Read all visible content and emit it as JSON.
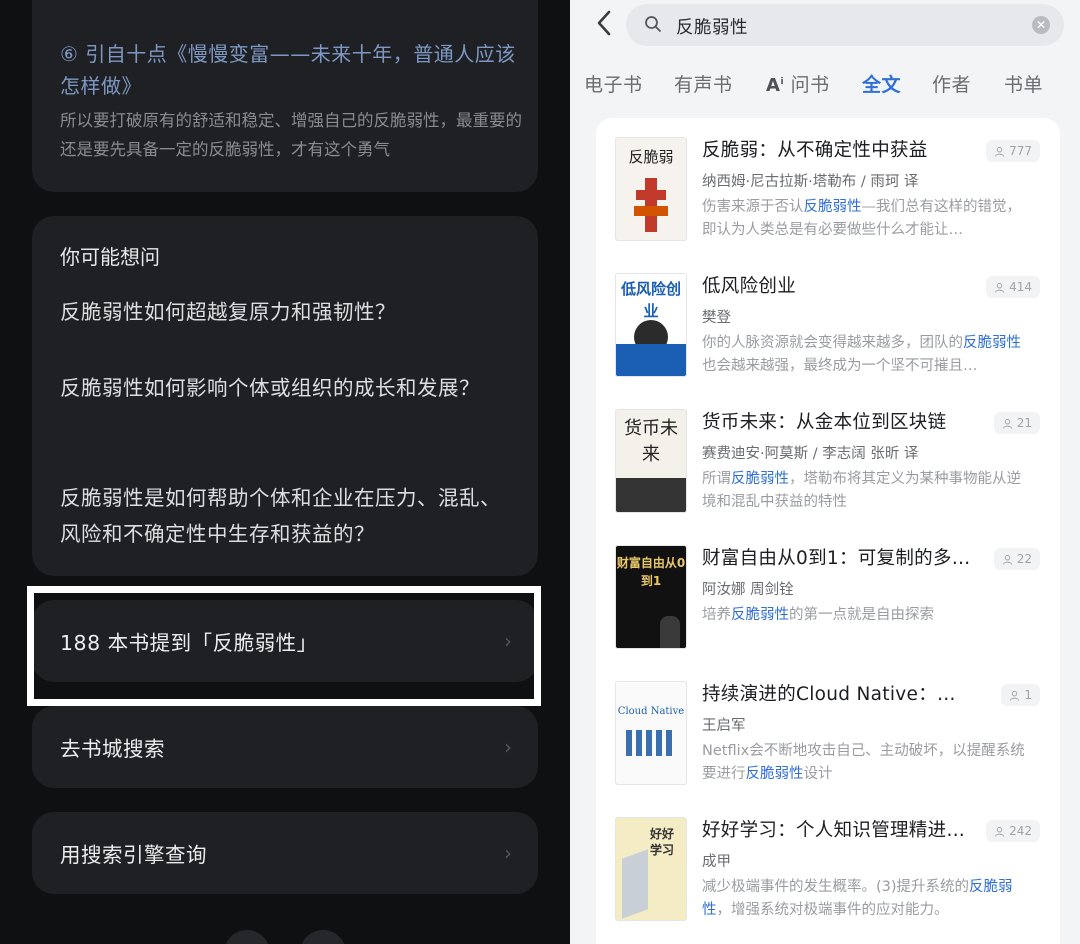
{
  "left": {
    "quote": {
      "title": "⑥ 引自十点《慢慢变富——未来十年，普通人应该怎样做》",
      "body": "所以要打破原有的舒适和稳定、增强自己的反脆弱性，最重要的还是要先具备一定的反脆弱性，才有这个勇气"
    },
    "ask": {
      "heading": "你可能想问",
      "questions": [
        "反脆弱性如何超越复原力和强韧性？",
        "反脆弱性如何影响个体或组织的成长和发展？",
        "反脆弱性是如何帮助个体和企业在压力、混乱、风险和不确定性中生存和获益的？"
      ]
    },
    "rows": {
      "books_mention": "188 本书提到「反脆弱性」",
      "store_search": "去书城搜索",
      "engine_search": "用搜索引擎查询"
    }
  },
  "right": {
    "search": {
      "query": "反脆弱性"
    },
    "tabs": [
      "电子书",
      "有声书",
      "问书",
      "全文",
      "作者",
      "书单"
    ],
    "active_tab": "全文",
    "results": [
      {
        "title": "反脆弱：从不确定性中获益",
        "author": "纳西姆·尼古拉斯·塔勒布 / 雨珂 译",
        "snippet_pre": "伤害来源于否认",
        "snippet_hl": "反脆弱性",
        "snippet_post": "—我们总有这样的错觉，即认为人类总是有必要做些什么才能让…",
        "count": "777",
        "cover_text": "反脆弱"
      },
      {
        "title": "低风险创业",
        "author": "樊登",
        "snippet_pre": "你的人脉资源就会变得越来越多，团队的",
        "snippet_hl": "反脆弱性",
        "snippet_post": "也会越来越强，最终成为一个坚不可摧且…",
        "count": "414",
        "cover_text": "低风险创业"
      },
      {
        "title": "货币未来：从金本位到区块链",
        "author": "赛费迪安·阿莫斯 / 李志阔 张昕 译",
        "snippet_pre": "所谓",
        "snippet_hl": "反脆弱性",
        "snippet_post": "，塔勒布将其定义为某种事物能从逆境和混乱中获益的特性",
        "count": "21",
        "cover_text": "货币未来"
      },
      {
        "title": "财富自由从0到1：可复制的多…",
        "author": "阿汝娜 周剑铨",
        "snippet_pre": "培养",
        "snippet_hl": "反脆弱性",
        "snippet_post": "的第一点就是自由探索",
        "count": "22",
        "cover_text": "财富自由从0到1"
      },
      {
        "title": "持续演进的Cloud Native：云…",
        "author": "王启军",
        "snippet_pre": "Netflix会不断地攻击自己、主动破坏，以提醒系统要进行",
        "snippet_hl": "反脆弱性",
        "snippet_post": "设计",
        "count": "1",
        "cover_text": "Cloud Native"
      },
      {
        "title": "好好学习：个人知识管理精进…",
        "author": "成甲",
        "snippet_pre": "减少极端事件的发生概率。(3)提升系统的",
        "snippet_hl": "反脆弱性",
        "snippet_post": "，增强系统对极端事件的应对能力。",
        "count": "242",
        "cover_text": "好好学习"
      }
    ]
  }
}
